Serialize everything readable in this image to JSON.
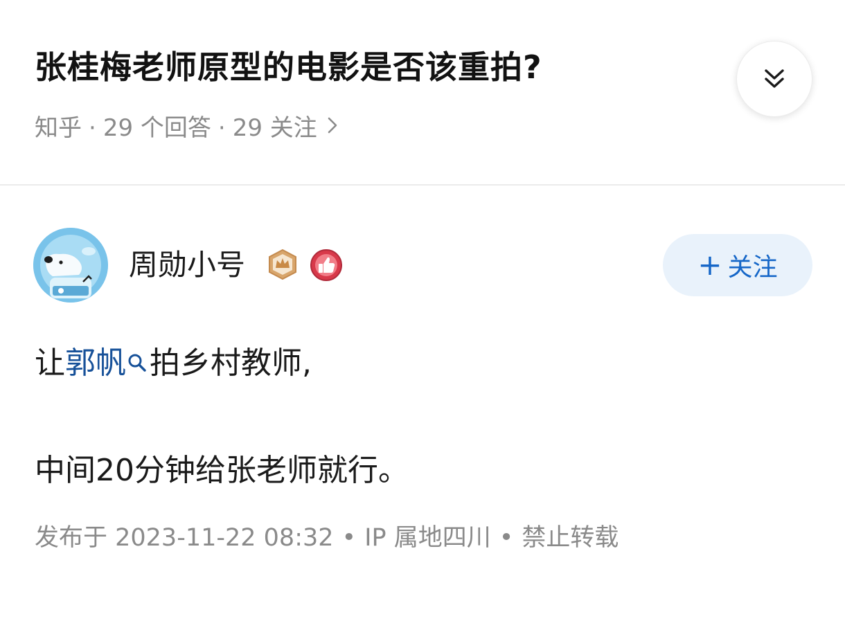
{
  "question": {
    "title": "张桂梅老师原型的电影是否该重拍?",
    "source": "知乎",
    "answers": "29 个回答",
    "followers": "29 关注",
    "meta_sep": "·",
    "more_icon": "chevron-right-icon",
    "collapse_icon": "double-chevron-down-icon"
  },
  "author": {
    "name": "周勋小号",
    "avatar_icon": "polar-bear-avatar",
    "badges": [
      "crown-badge-icon",
      "thumbs-up-badge-icon"
    ],
    "follow_plus": "+",
    "follow_label": "关注"
  },
  "answer": {
    "line1_prefix": "让",
    "line1_link": "郭帆",
    "line1_suffix": "拍乡村教师,",
    "line2": "中间20分钟给张老师就行。",
    "published": "发布于 2023-11-22 08:32",
    "ip": "IP 属地四川",
    "copyright": "禁止转载",
    "dot": "•"
  },
  "colors": {
    "link": "#175199",
    "follow_bg": "#e9f2fb",
    "follow_text": "#1667c8",
    "meta": "#8a8a8a"
  }
}
